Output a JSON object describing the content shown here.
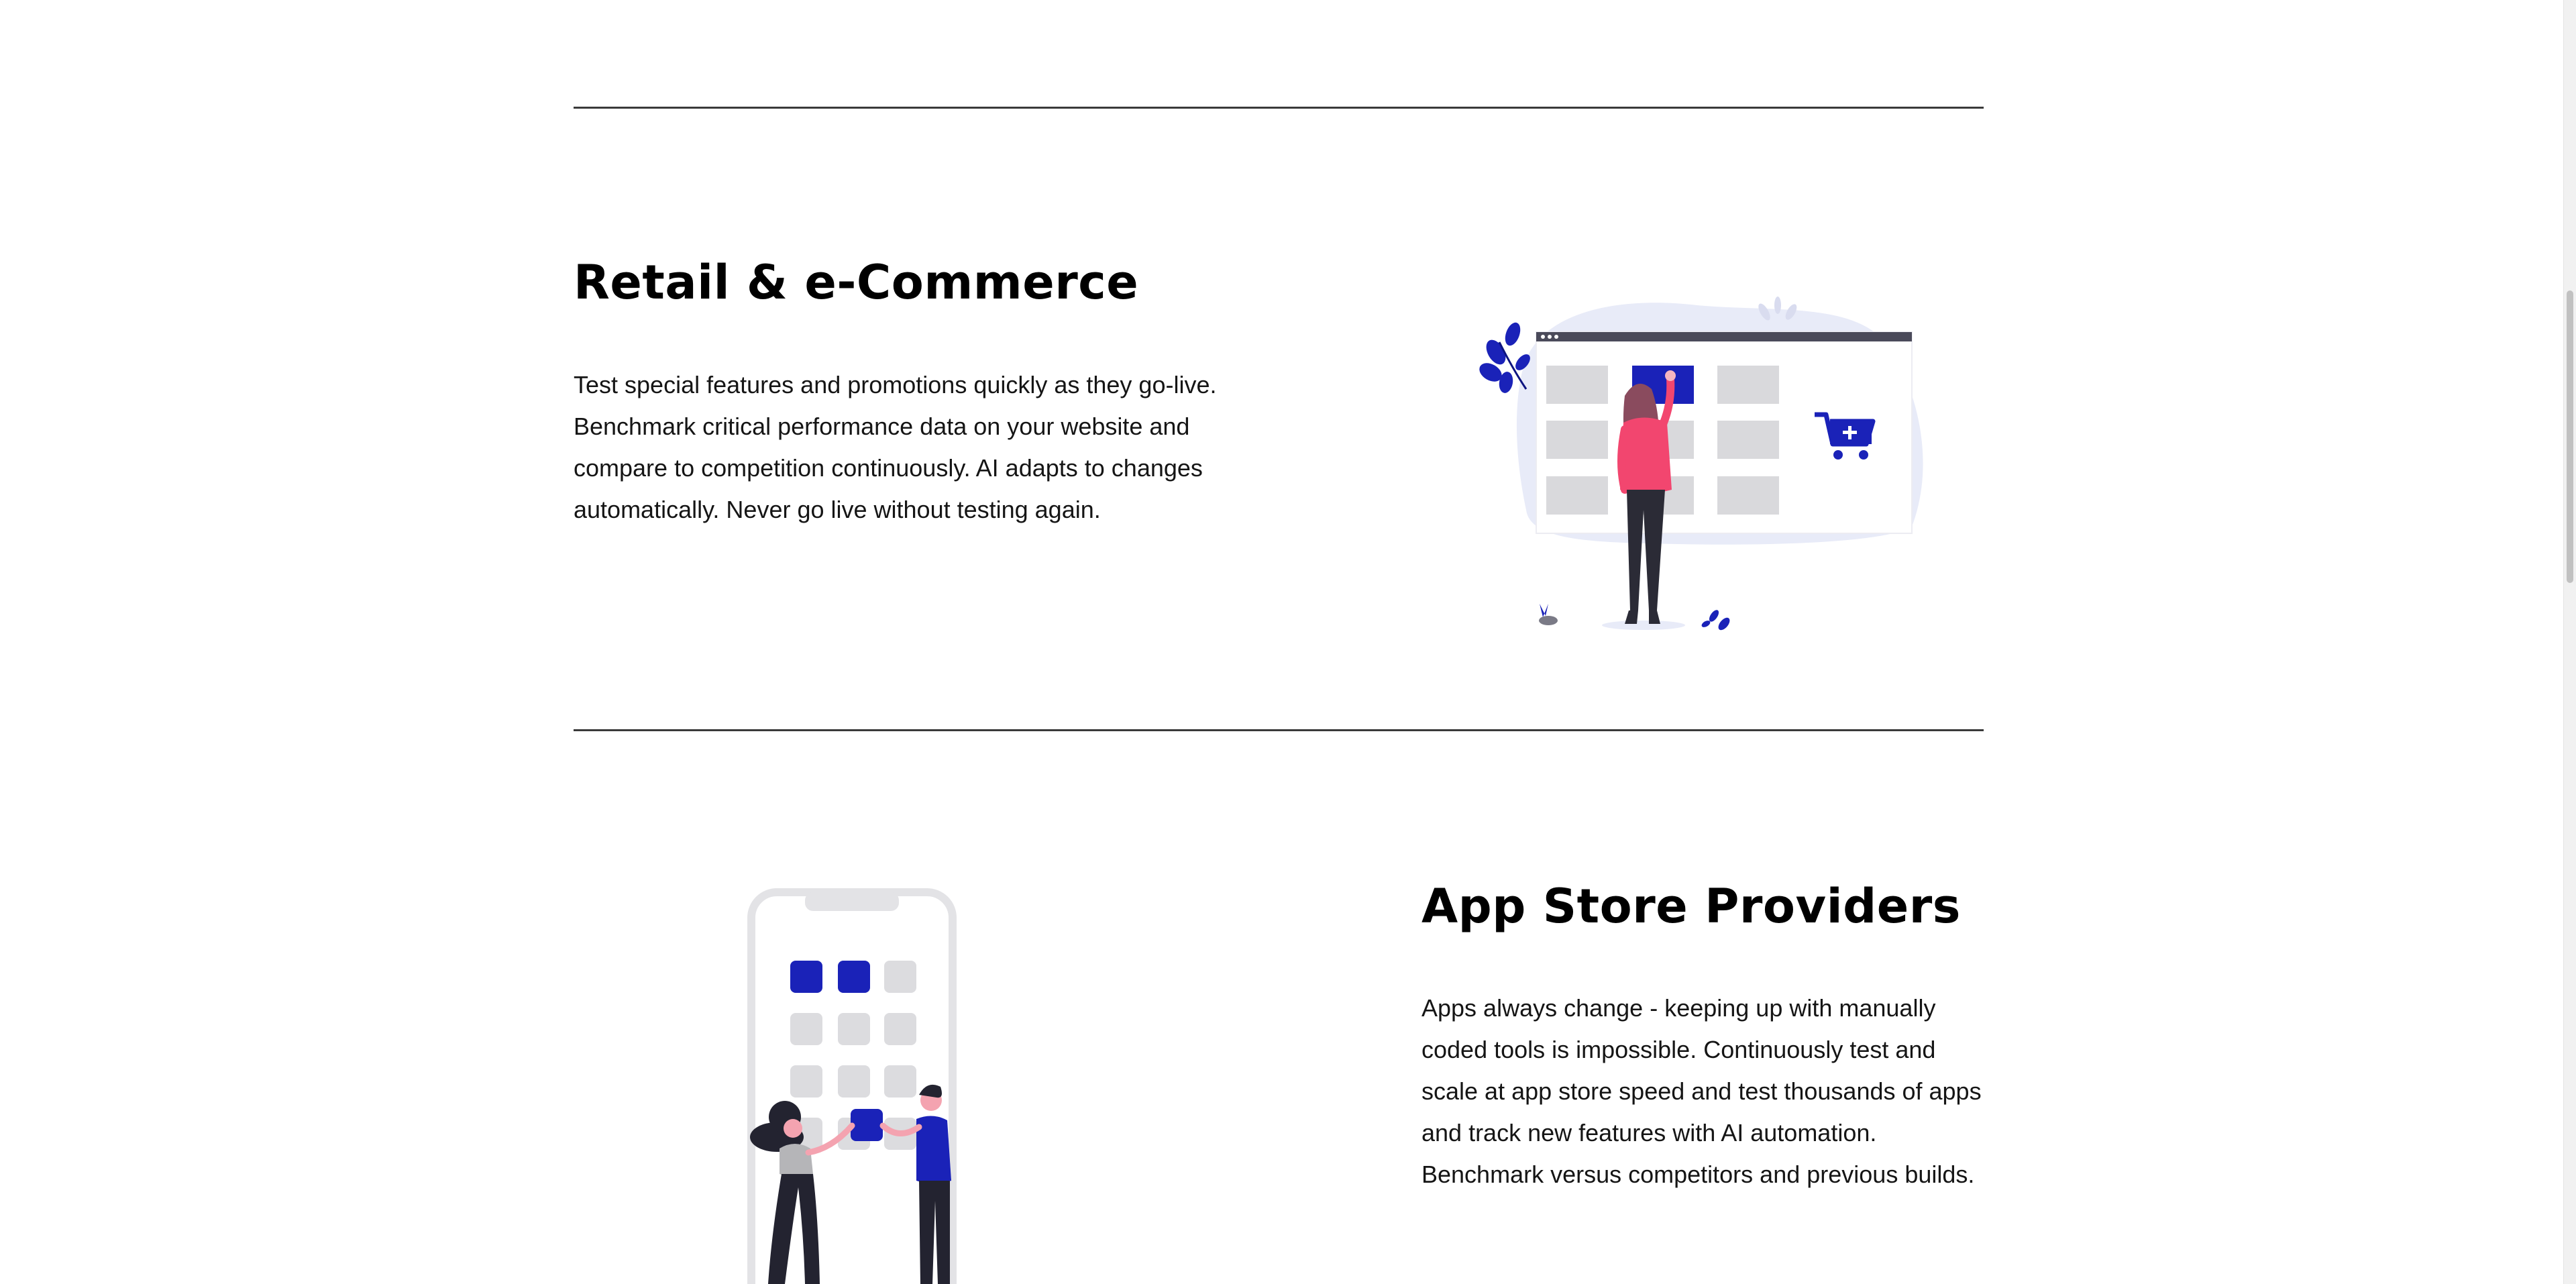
{
  "sections": [
    {
      "title": "Retail & e-Commerce",
      "lines": [
        "Test special features and promotions quickly as they go-live.",
        "Benchmark critical performance data on your website and",
        "compare to competition continuously. AI adapts to changes",
        "automatically. Never go live without testing again."
      ],
      "illustration": "woman-selecting-product-grid-with-cart"
    },
    {
      "title": "App Store Providers",
      "lines": [
        "Apps always change - keeping up with manually",
        "coded tools is impossible. Continuously test and",
        "scale at app store speed and test thousands of apps",
        "and track new features with AI automation.",
        "Benchmark versus competitors and previous builds."
      ],
      "illustration": "two-people-arranging-phone-apps"
    }
  ],
  "colors": {
    "accent": "#1a22b8",
    "accent_dark": "#0d1480",
    "figure_pink": "#f2466f",
    "tile_gray": "#d9d9dc",
    "blob": "#e8ebf8",
    "rule": "#3a3a3a"
  }
}
